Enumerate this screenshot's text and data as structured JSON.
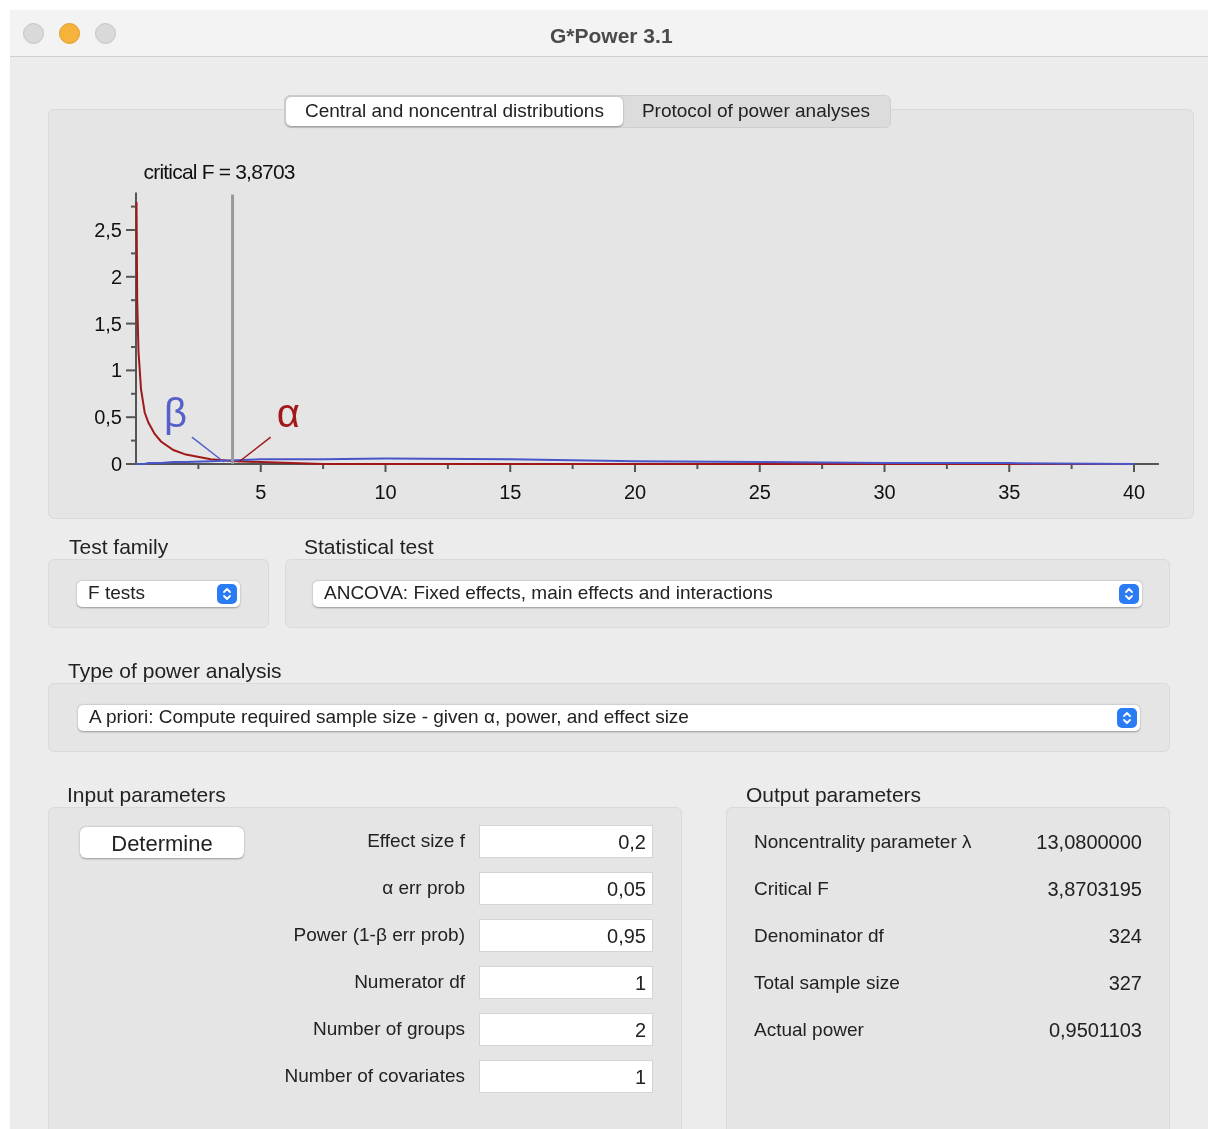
{
  "window": {
    "title": "G*Power 3.1"
  },
  "tabs": [
    {
      "label": "Central and noncentral distributions",
      "selected": true
    },
    {
      "label": "Protocol of power analyses",
      "selected": false
    }
  ],
  "distribution_plot": {
    "chart_data": {
      "type": "line",
      "x": [
        0.02,
        0.05,
        0.1,
        0.2,
        0.35,
        0.5,
        0.75,
        1,
        1.5,
        2,
        3,
        4,
        5,
        7.5,
        10,
        15,
        20,
        25,
        30,
        35,
        40
      ],
      "series": [
        {
          "color": "#a01818",
          "values": [
            2.8,
            1.75,
            1.2,
            0.8,
            0.55,
            0.44,
            0.32,
            0.24,
            0.15,
            0.1,
            0.05,
            0.03,
            0.02,
            0,
            0,
            0,
            0,
            0,
            0,
            0,
            0
          ]
        },
        {
          "color": "#4a56c8",
          "values": [
            0,
            0,
            0,
            0,
            0,
            0.01,
            0.01,
            0.01,
            0.02,
            0.02,
            0.03,
            0.04,
            0.05,
            0.05,
            0.06,
            0.05,
            0.03,
            0.02,
            0.01,
            0.01,
            0
          ]
        }
      ],
      "ref_lines": [
        {
          "axis": "x",
          "value": 3.87,
          "color": "#999999"
        }
      ],
      "xlim": [
        0,
        41
      ],
      "ylim": [
        0,
        2.9
      ],
      "xticks": [
        5,
        10,
        15,
        20,
        25,
        30,
        35,
        40
      ],
      "yticks": [
        0,
        {
          "value": 0.5,
          "label": "0,5"
        },
        1,
        {
          "value": 1.5,
          "label": "1,5"
        },
        2,
        {
          "value": 2.5,
          "label": "2,5"
        }
      ],
      "annotations": [
        "critical F = 3,8703",
        "β",
        "α"
      ]
    }
  },
  "test_family": {
    "label": "Test family",
    "value": "F tests"
  },
  "statistical_test": {
    "label": "Statistical test",
    "value": "ANCOVA: Fixed effects, main effects and interactions"
  },
  "power_analysis_type": {
    "label": "Type of power analysis",
    "value": "A priori: Compute required sample size - given α, power, and effect size"
  },
  "input_parameters": {
    "title": "Input parameters",
    "determine_button": "Determine",
    "fields": [
      {
        "label": "Effect size f",
        "value": "0,2"
      },
      {
        "label": "α err prob",
        "value": "0,05"
      },
      {
        "label": "Power (1-β err prob)",
        "value": "0,95"
      },
      {
        "label": "Numerator df",
        "value": "1"
      },
      {
        "label": "Number of groups",
        "value": "2"
      },
      {
        "label": "Number of covariates",
        "value": "1"
      }
    ]
  },
  "output_parameters": {
    "title": "Output parameters",
    "rows": [
      {
        "label": "Noncentrality parameter λ",
        "value": "13,0800000"
      },
      {
        "label": "Critical F",
        "value": "3,8703195"
      },
      {
        "label": "Denominator df",
        "value": "324"
      },
      {
        "label": "Total sample size",
        "value": "327"
      },
      {
        "label": "Actual power",
        "value": "0,9501103"
      }
    ]
  }
}
